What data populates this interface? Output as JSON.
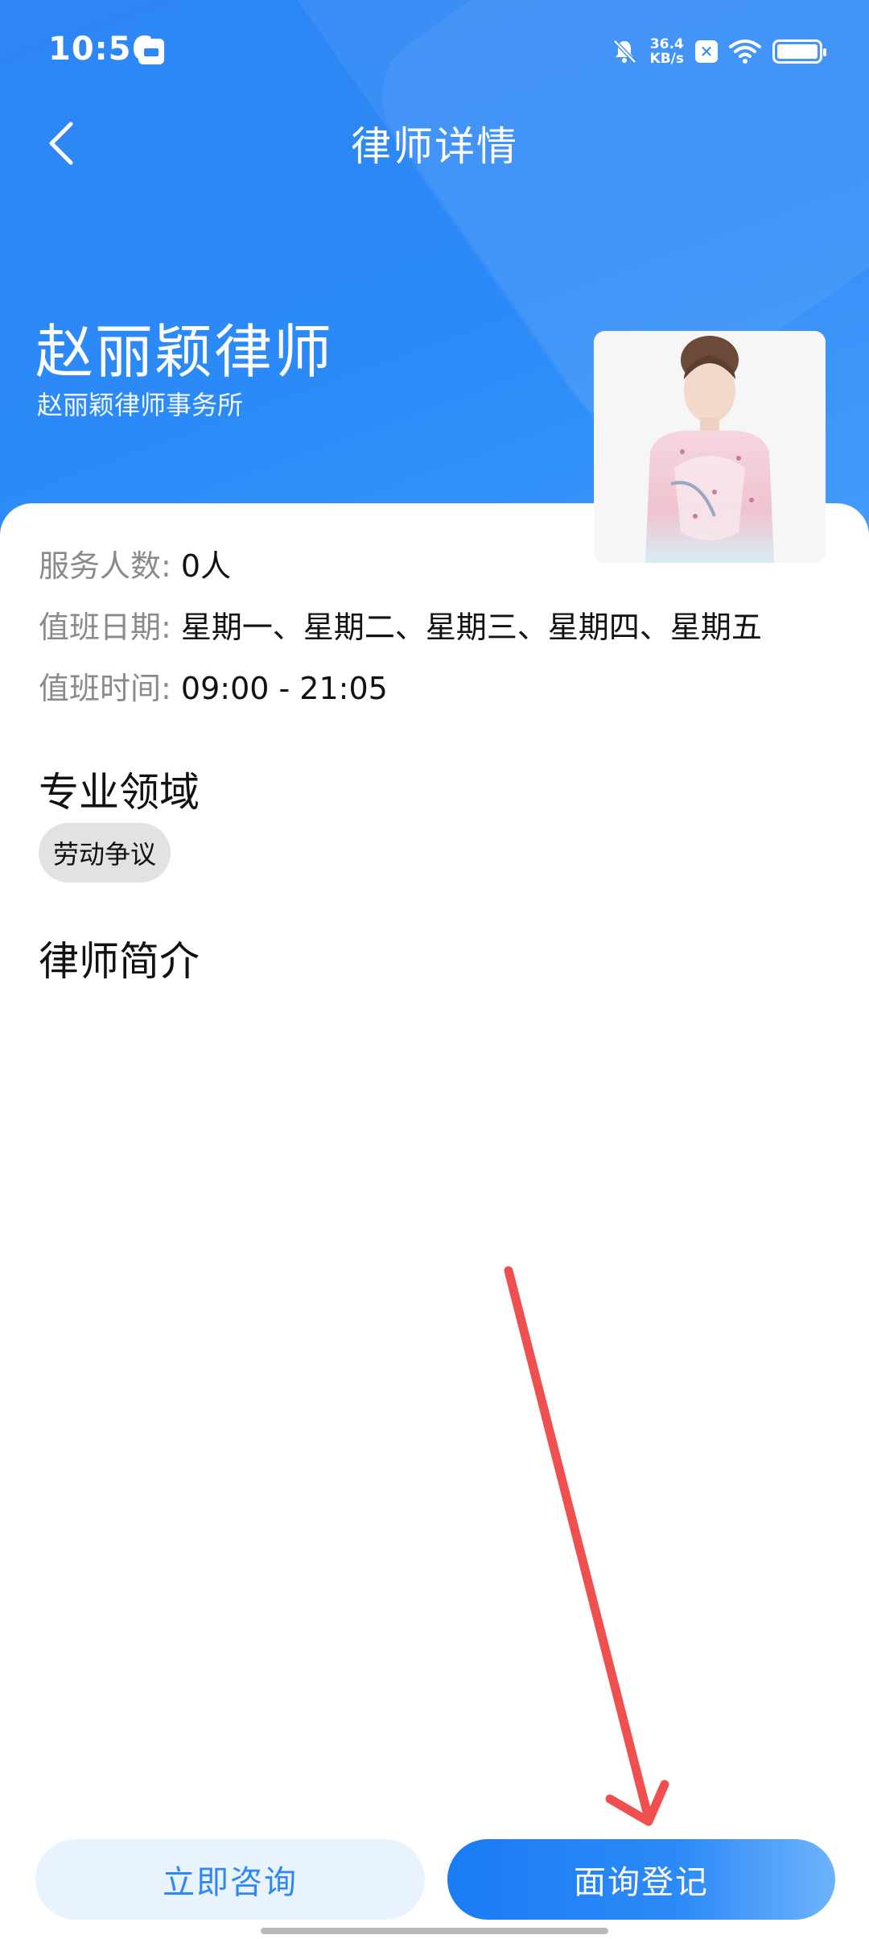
{
  "status_bar": {
    "time": "10:56",
    "network_speed_value": "36.4",
    "network_speed_unit": "KB/s",
    "icons": [
      "app-notification-icon",
      "mute-bell-icon",
      "nfc-icon",
      "wifi-icon",
      "battery-icon"
    ]
  },
  "nav": {
    "title": "律师详情",
    "back_icon": "chevron-left-icon"
  },
  "lawyer": {
    "name": "赵丽颖律师",
    "firm": "赵丽颖律师事务所"
  },
  "info": {
    "service_label": "服务人数:",
    "service_value": "0人",
    "days_label": "值班日期:",
    "days_value": "星期一、星期二、星期三、星期四、星期五",
    "time_label": "值班时间:",
    "time_value": "09:00 - 21:05"
  },
  "sections": {
    "expertise_title": "专业领域",
    "expertise_tags": [
      "劳动争议"
    ],
    "intro_title": "律师简介"
  },
  "actions": {
    "consult_label": "立即咨询",
    "register_label": "面询登记"
  },
  "colors": {
    "header_blue": "#2f86f6",
    "primary_button": "#1a7cf4",
    "secondary_button_bg": "#e8f3fd",
    "annotation_arrow": "#ef4f4f"
  }
}
